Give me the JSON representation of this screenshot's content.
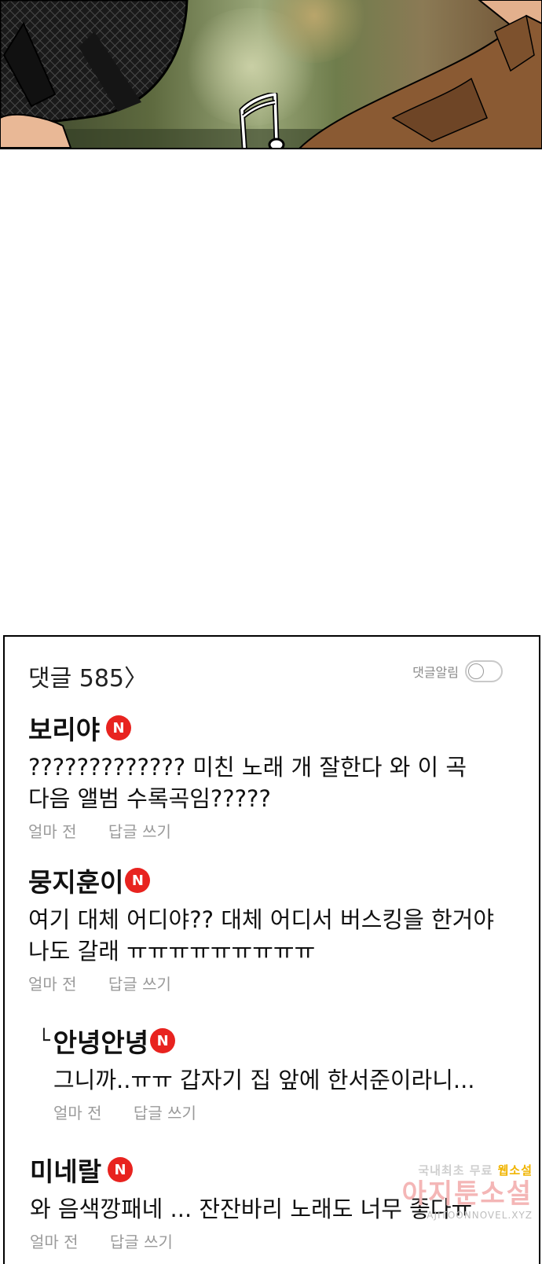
{
  "comments_section": {
    "title": "댓글 585〉",
    "notify_label": "댓글알림",
    "notify_on": false,
    "badge_color": "#e8231f",
    "items": [
      {
        "author": "보리야",
        "badge": "N",
        "text": "????????????? 미친 노래 개 잘한다 와 이 곡\n다음 앨범 수록곡임?????",
        "time": "얼마 전",
        "reply": "답글 쓰기"
      },
      {
        "author": "뭉지훈이",
        "badge": "N",
        "text": "여기 대체 어디야?? 대체 어디서 버스킹을 한거야\n나도 갈래 ㅠㅠㅠㅠㅠㅠㅠㅠㅠ",
        "time": "얼마 전",
        "reply": "답글 쓰기"
      },
      {
        "reply_mark": "└",
        "author": "안녕안녕",
        "badge": "N",
        "text": "그니까..ㅠㅠ 갑자기 집 앞에 한서준이라니...",
        "time": "얼마 전",
        "reply": "답글 쓰기"
      },
      {
        "author": "미네랄",
        "badge": "N",
        "text": "와 음색깡패네 ... 잔잔바리 노래도 너무 좋다ㅠ",
        "time": "얼마 전",
        "reply": "답글 쓰기"
      }
    ]
  },
  "watermark": {
    "top_prefix": "국내최초 무료",
    "top_highlight": "웹소설",
    "main": "아지툰소설",
    "sub": "AJITOONNOVEL.XYZ"
  }
}
